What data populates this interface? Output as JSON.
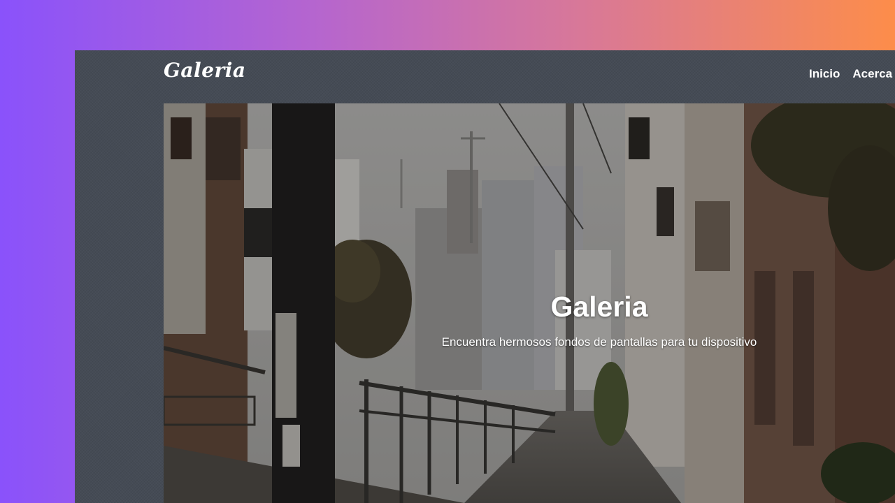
{
  "navbar": {
    "brand": "Galeria",
    "links": [
      {
        "label": "Inicio"
      },
      {
        "label": "Acerca de"
      }
    ]
  },
  "hero": {
    "title": "Galeria",
    "subtitle": "Encuentra hermosos fondos de pantallas para tu dispositivo",
    "image_description_icon": "street-photo"
  },
  "colors": {
    "background_gradient_start": "#8a52fb",
    "background_gradient_end": "#fd8d4a",
    "window_background": "#454b55",
    "text": "#ffffff"
  }
}
